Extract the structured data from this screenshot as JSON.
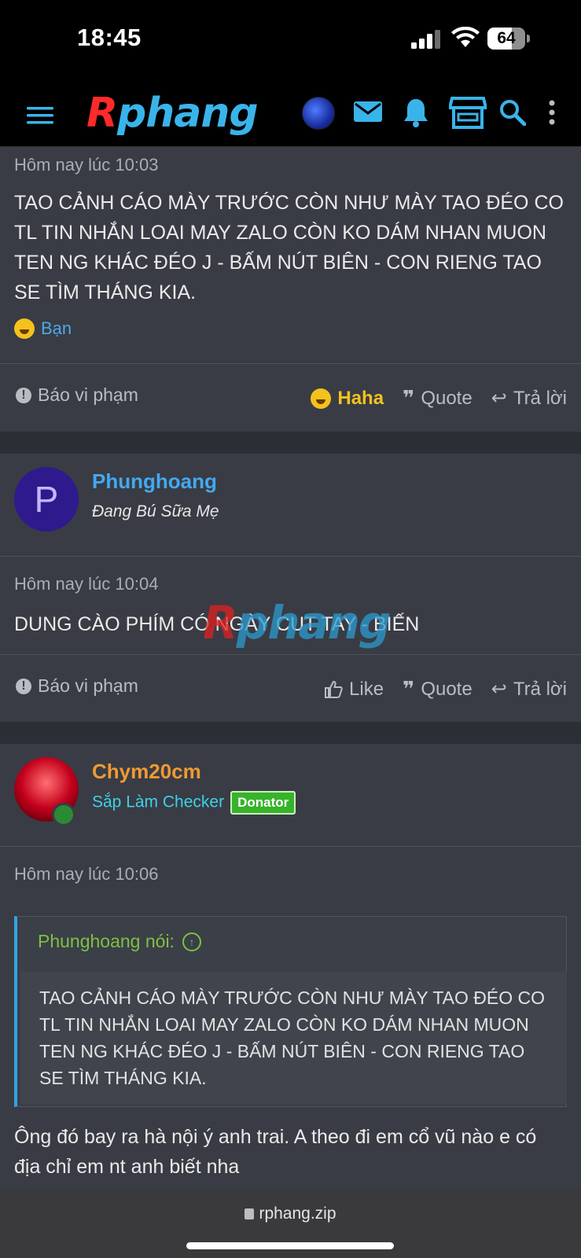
{
  "status_bar": {
    "time": "18:45",
    "battery": "64",
    "battery_level": 0.64
  },
  "navbar": {
    "logo_first": "R",
    "logo_rest": "phang",
    "icons": [
      "menu-icon",
      "user-avatar",
      "mail-icon",
      "bell-icon",
      "store-icon",
      "search-icon",
      "more-vertical-icon"
    ]
  },
  "post1": {
    "timestamp": "Hôm nay lúc 10:03",
    "body": "TAO CẢNH CÁO MÀY TRƯỚC CÒN NHƯ MÀY TAO ĐÉO CO TL TIN NHẮN LOAI MAY ZALO CÒN KO DÁM NHAN MUON TEN NG KHÁC ĐÉO J - BẤM NÚT BIÊN - CON RIENG TAO SE TÌM THÁNG KIA.",
    "reaction_label": "Bạn",
    "report": "Báo vi phạm",
    "haha": "Haha",
    "quote": "Quote",
    "reply": "Trả lời"
  },
  "post2": {
    "username": "Phunghoang",
    "user_title": "Đang Bú Sữa Mẹ",
    "avatar_letter": "P",
    "timestamp": "Hôm nay lúc 10:04",
    "body": "DUNG CÀO PHÍM CÓ NGÀY CUT TAY - BIẾN",
    "report": "Báo vi phạm",
    "like": "Like",
    "quote": "Quote",
    "reply": "Trả lời"
  },
  "post3": {
    "username": "Chym20cm",
    "user_title": "Sắp Làm Checker",
    "badge": "Donator",
    "timestamp": "Hôm nay lúc 10:06",
    "quote_author": "Phunghoang nói:",
    "quote_text": "TAO CẢNH CÁO MÀY TRƯỚC CÒN NHƯ MÀY TAO ĐÉO CO TL TIN NHẮN LOAI MAY ZALO CÒN KO DÁM NHAN MUON TEN NG KHÁC ĐÉO J - BẤM NÚT BIÊN - CON RIENG TAO SE TÌM THÁNG KIA.",
    "body": "Ông đó bay ra hà nội ý anh trai. A theo đi em cổ vũ nào e có địa chỉ em nt anh biết nha"
  },
  "watermark": {
    "first": "R",
    "rest": "phang"
  },
  "browser": {
    "url": "rphang.zip"
  },
  "colors": {
    "background": "#2b2e34",
    "post_bg": "#393c44",
    "accent_blue": "#34a3e6",
    "username_blue": "#43a9f0",
    "username_orange": "#f09a32",
    "user_title_teal": "#3fd0e8",
    "quote_green": "#7dc143",
    "haha_yellow": "#f4c21d",
    "donator_green": "#37b32a"
  }
}
